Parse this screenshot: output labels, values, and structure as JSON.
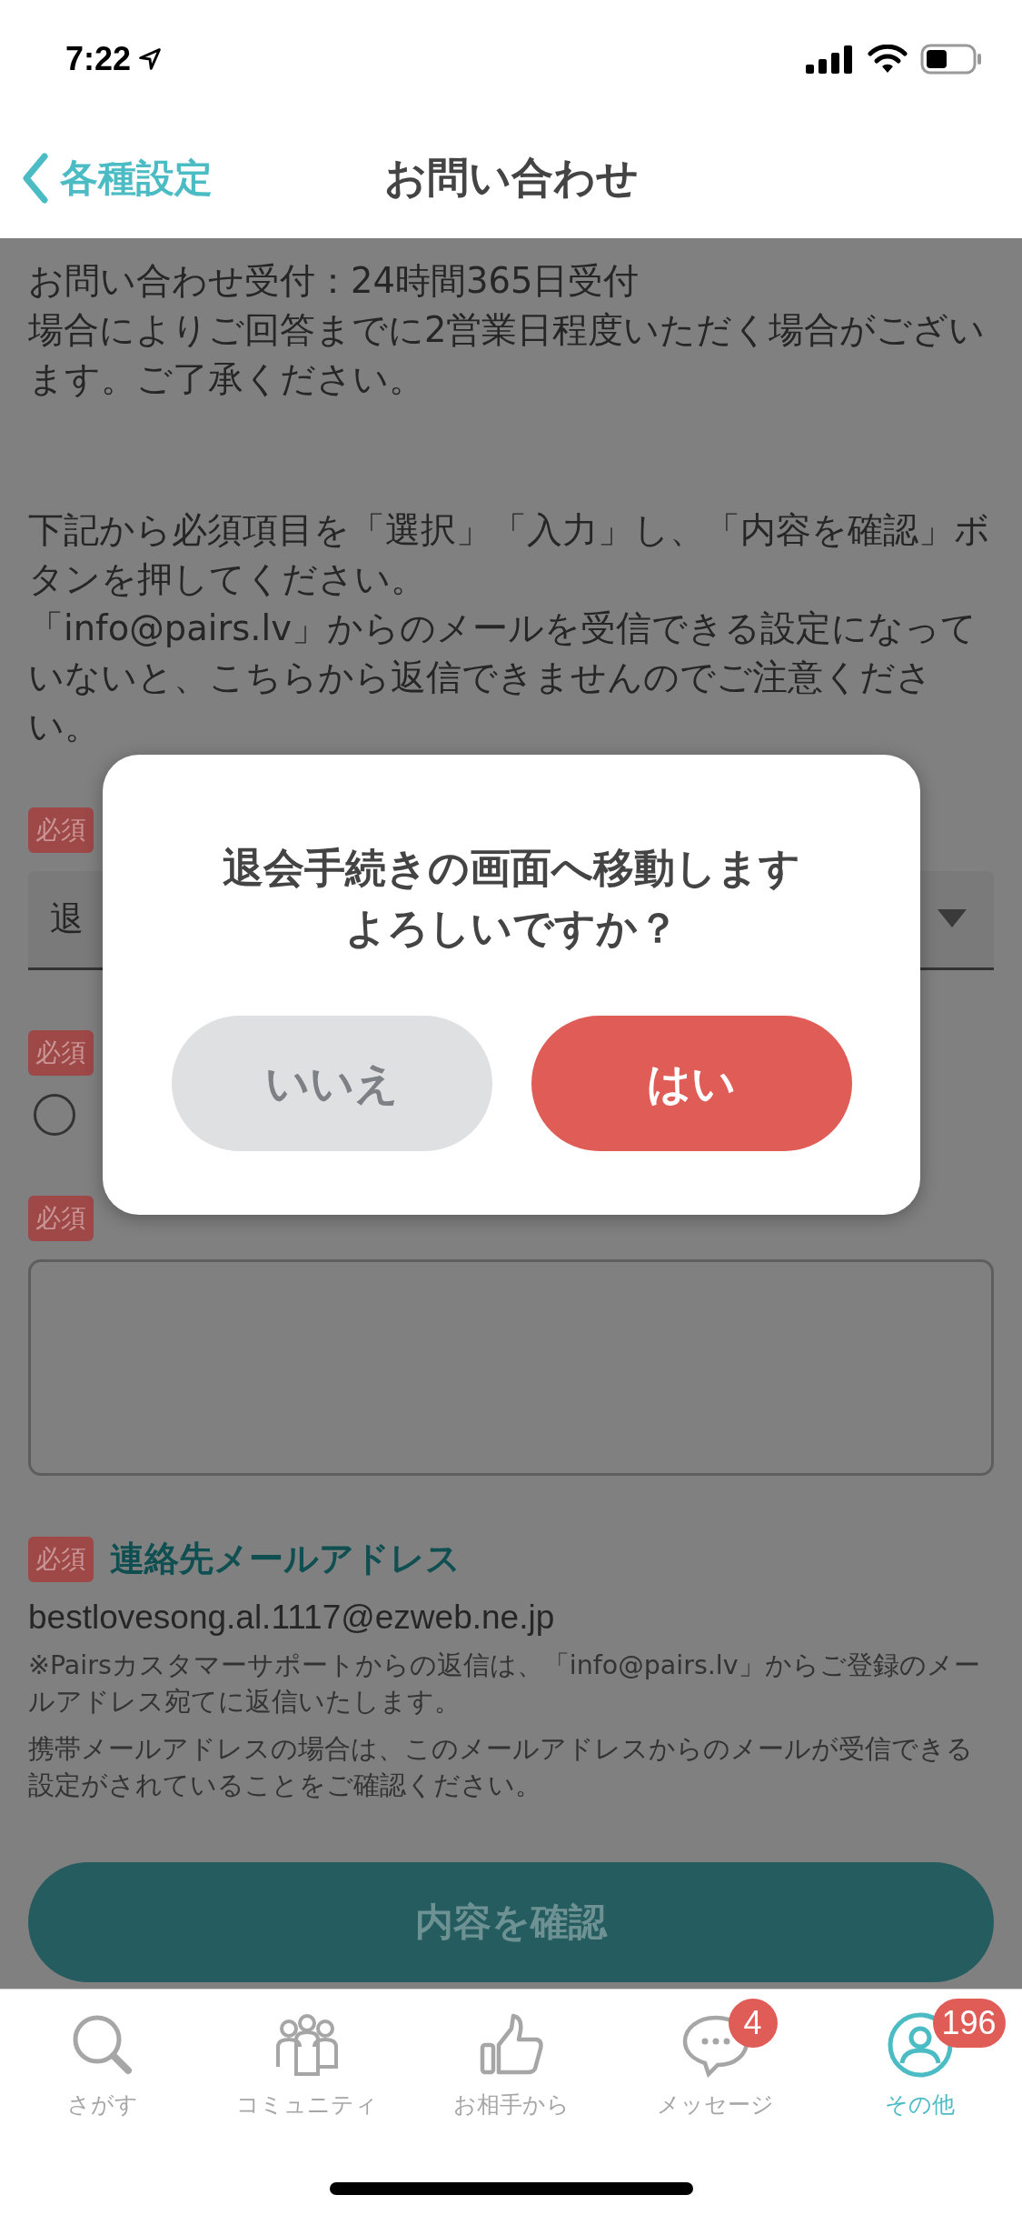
{
  "status_bar": {
    "time": "7:22"
  },
  "nav": {
    "back_label": "各種設定",
    "title": "お問い合わせ"
  },
  "intro": [
    "お問い合わせ受付：24時間365日受付",
    "場合によりご回答までに2営業日程度いただく場合がございます。ご了承ください。"
  ],
  "instructions": [
    "下記から必須項目を「選択」「入力」し、「内容を確認」ボタンを押してください。",
    "「info@pairs.lv」からのメールを受信できる設定になっていないと、こちらから返信できませんのでご注意ください。"
  ],
  "form": {
    "fields": [
      {
        "kind": "select",
        "badge": "必須",
        "value": "退"
      },
      {
        "kind": "radio",
        "badge": "必須",
        "checked": false
      },
      {
        "kind": "textarea",
        "badge": "必須"
      },
      {
        "kind": "email",
        "badge": "必須",
        "label": "連絡先メールアドレス",
        "value": "bestlovesong.al.1117@ezweb.ne.jp",
        "notes": [
          "※Pairsカスタマーサポートからの返信は、「info@pairs.lv」からご登録のメールアドレス宛てに返信いたします。",
          "携帯メールアドレスの場合は、このメールアドレスからのメールが受信できる設定がされていることをご確認ください。"
        ]
      }
    ],
    "submit": "内容を確認"
  },
  "dialog": {
    "message": [
      "退会手続きの画面へ移動します",
      "よろしいですか？"
    ],
    "buttons": [
      {
        "kind": "cancel",
        "label": "いいえ"
      },
      {
        "kind": "confirm",
        "label": "はい"
      }
    ]
  },
  "tabs": [
    {
      "kind": "search",
      "label": "さがす",
      "selected": false
    },
    {
      "kind": "community",
      "label": "コミュニティ",
      "selected": false
    },
    {
      "kind": "likes",
      "label": "お相手から",
      "selected": false
    },
    {
      "kind": "messages",
      "label": "メッセージ",
      "selected": false,
      "badge": "4"
    },
    {
      "kind": "other",
      "label": "その他",
      "selected": true,
      "badge": "196"
    }
  ]
}
